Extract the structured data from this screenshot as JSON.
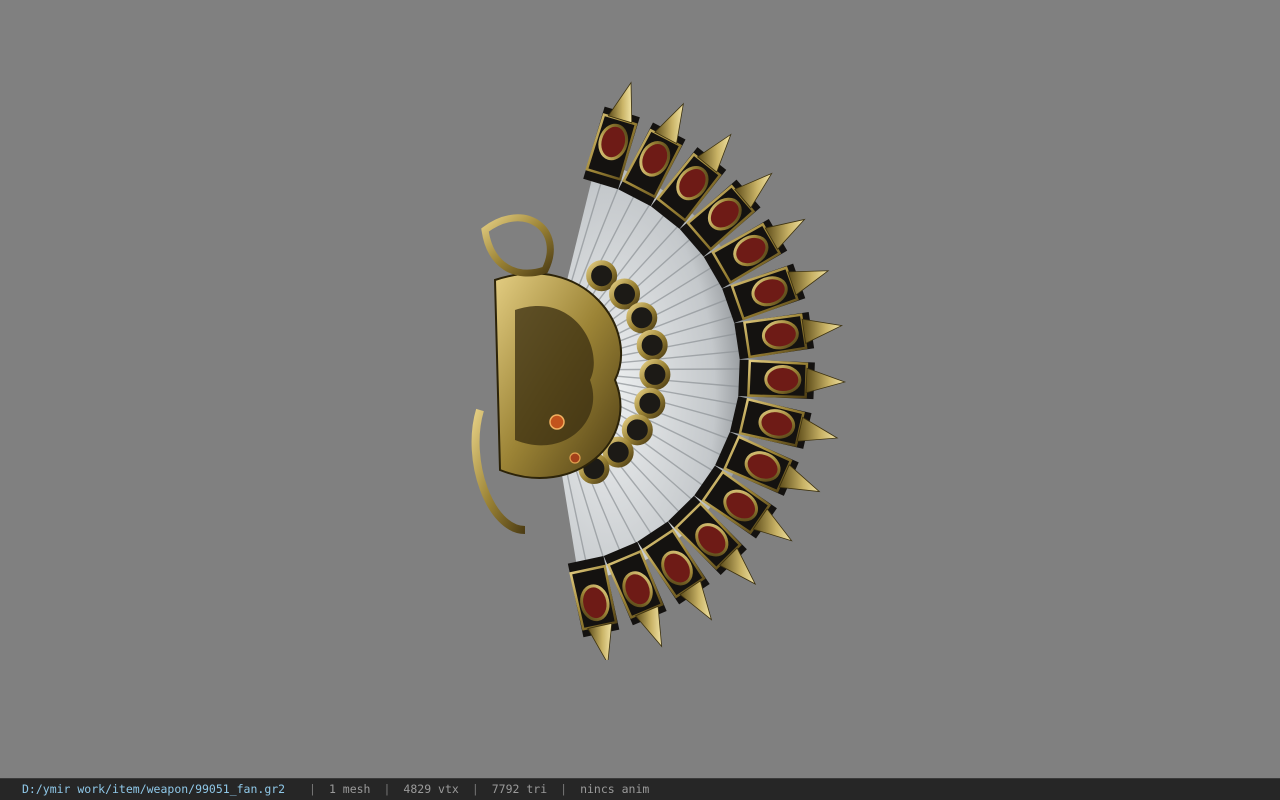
{
  "viewport": {
    "background": "#808080",
    "model": {
      "kind": "ornate fan weapon mesh",
      "colors": {
        "gold": "#a08838",
        "gold_light": "#d8c27a",
        "red": "#6e1b16",
        "black": "#141210",
        "white_feather": "#c9cdd0"
      }
    }
  },
  "statusbar": {
    "path": "D:/ymir work/item/weapon/99051_fan.gr2",
    "stats": [
      "1 mesh",
      "4829 vtx",
      "7792 tri",
      "nincs anim"
    ],
    "separator": "|"
  }
}
